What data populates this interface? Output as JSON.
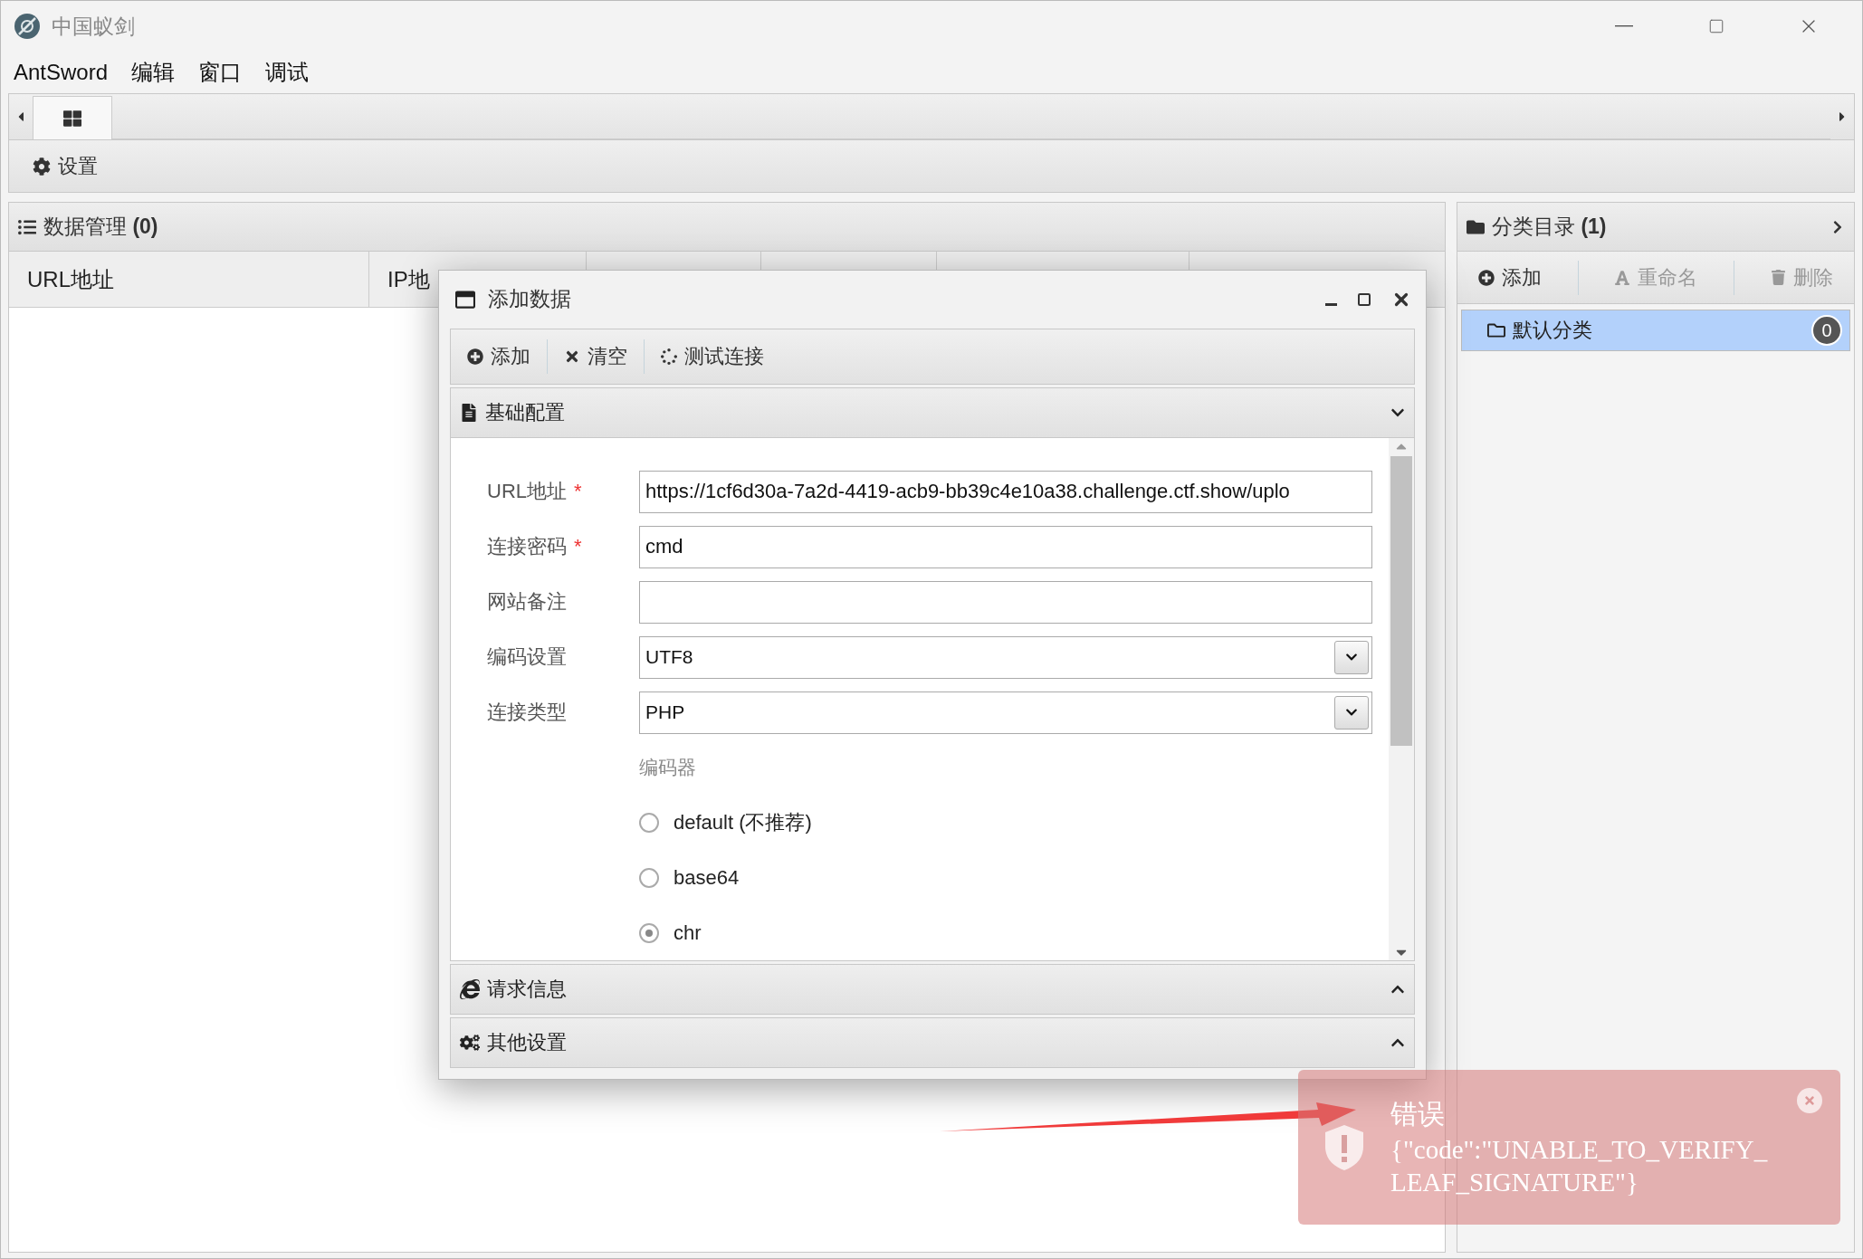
{
  "window": {
    "title": "中国蚁剑"
  },
  "menu": [
    "AntSword",
    "编辑",
    "窗口",
    "调试"
  ],
  "tabs": [
    {
      "selected": true
    }
  ],
  "toolbar": {
    "settings": "设置"
  },
  "data_panel": {
    "title": "数据管理 **(0)**",
    "columns": [
      "URL地址",
      "IP地"
    ]
  },
  "category_panel": {
    "title": "分类目录 **(1)**",
    "actions": [
      {
        "kind": "add",
        "label": "添加",
        "disabled": false
      },
      {
        "kind": "rename",
        "label": "重命名",
        "disabled": true
      },
      {
        "kind": "delete",
        "label": "删除",
        "disabled": true
      }
    ],
    "items": [
      {
        "label": "默认分类",
        "count": "0",
        "selected": true
      }
    ]
  },
  "dialog": {
    "title": "添加数据",
    "required_mark": "*",
    "toolbar": [
      {
        "kind": "add",
        "label": "添加"
      },
      {
        "kind": "clear",
        "label": "清空"
      },
      {
        "kind": "test",
        "label": "测试连接"
      }
    ],
    "sections": [
      {
        "kind": "basic",
        "title": "基础配置",
        "expanded": true
      },
      {
        "kind": "request",
        "title": "请求信息",
        "expanded": false
      },
      {
        "kind": "other",
        "title": "其他设置",
        "expanded": false
      }
    ],
    "fields": [
      {
        "kind": "text",
        "label": "URL地址",
        "required": true,
        "value": "https://1cf6d30a-7a2d-4419-acb9-bb39c4e10a38.challenge.ctf.show/uplo"
      },
      {
        "kind": "text",
        "label": "连接密码",
        "required": true,
        "value": "cmd"
      },
      {
        "kind": "text",
        "label": "网站备注",
        "required": false
      },
      {
        "kind": "select",
        "label": "编码设置",
        "required": false,
        "value": "UTF8"
      },
      {
        "kind": "select",
        "label": "连接类型",
        "required": false,
        "value": "PHP"
      }
    ],
    "encoder": {
      "label": "编码器",
      "options": [
        {
          "label": "default (不推荐)",
          "selected": false
        },
        {
          "label": "base64",
          "selected": false
        },
        {
          "label": "chr",
          "selected": true
        }
      ]
    }
  },
  "toast": {
    "title": "错误",
    "message": "{\"code\":\"UNABLE_TO_VERIFY_LEAF_SIGNATURE\"}"
  }
}
